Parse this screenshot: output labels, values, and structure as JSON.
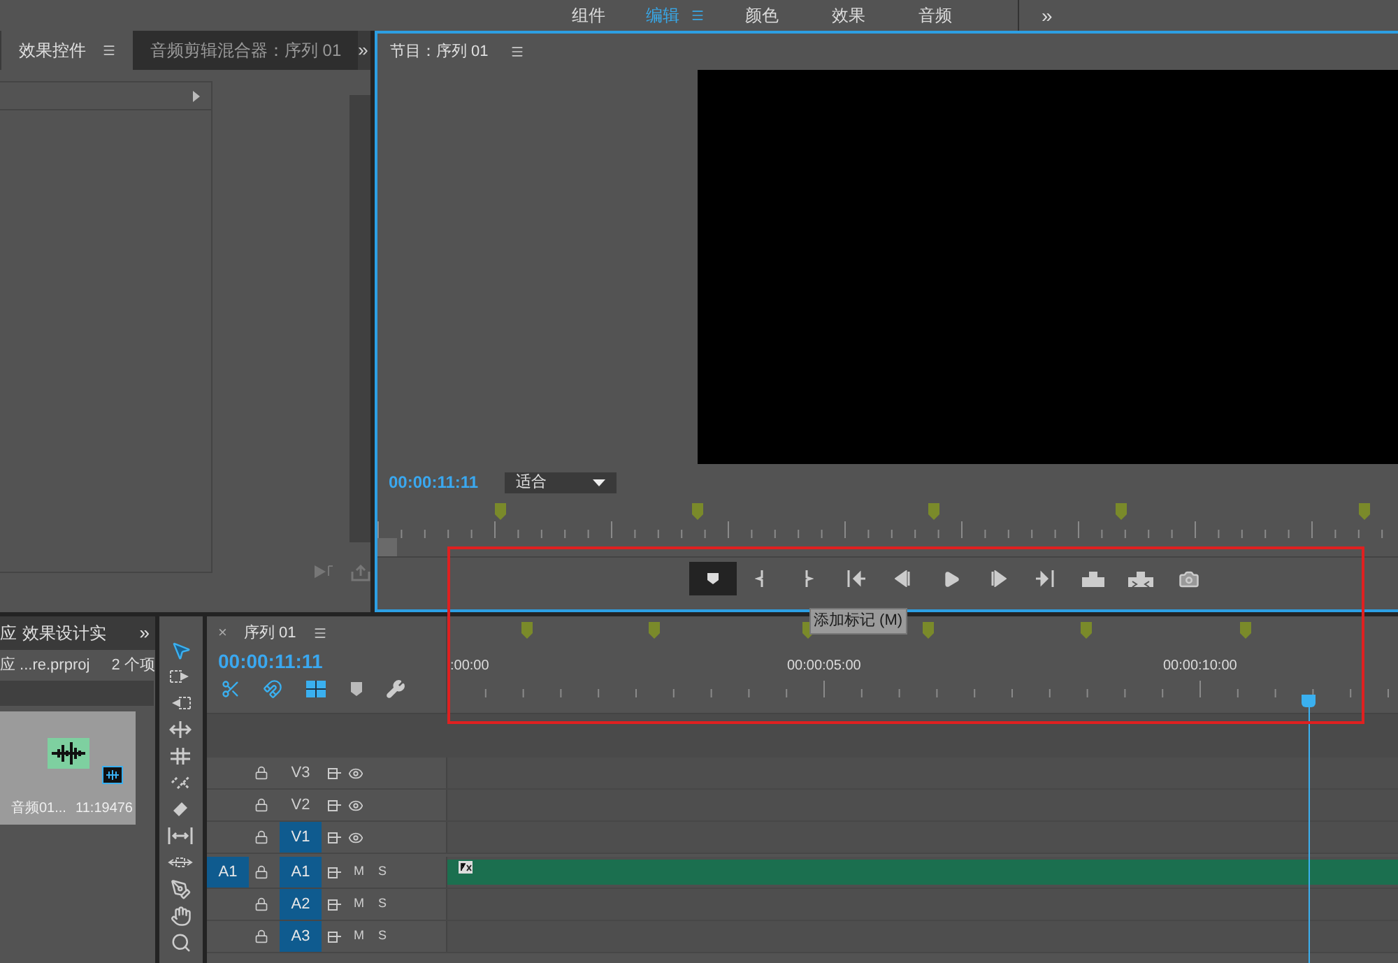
{
  "workspaces": [
    {
      "label": "组件",
      "selected": false
    },
    {
      "label": "编辑",
      "selected": true
    },
    {
      "label": "颜色",
      "selected": false
    },
    {
      "label": "效果",
      "selected": false
    },
    {
      "label": "音频",
      "selected": false
    }
  ],
  "workspace_more": "»",
  "effects_panel": {
    "tabs": [
      {
        "label": "效果控件",
        "selected": true
      },
      {
        "label": "音频剪辑混合器：序列 01",
        "selected": false
      }
    ],
    "more": "»"
  },
  "program_monitor": {
    "title": "节目：序列 01",
    "timecode": "00:00:11:11",
    "zoom": "适合",
    "buttons": [
      {
        "kind": "marker",
        "hovered": true
      },
      {
        "kind": "mark-in",
        "hovered": false
      },
      {
        "kind": "mark-out",
        "hovered": false
      },
      {
        "kind": "go-in",
        "hovered": false
      },
      {
        "kind": "step-back",
        "hovered": false
      },
      {
        "kind": "play",
        "hovered": false
      },
      {
        "kind": "step-forward",
        "hovered": false
      },
      {
        "kind": "go-out",
        "hovered": false
      },
      {
        "kind": "lift",
        "hovered": false
      },
      {
        "kind": "extract",
        "hovered": false
      },
      {
        "kind": "export-frame",
        "hovered": false
      }
    ],
    "tooltip": "添加标记 (M)"
  },
  "project_panel": {
    "tabs": [
      "应",
      "效果设计实"
    ],
    "more": "»",
    "project_name": "应 ...re.prproj",
    "item_count": "2 个项",
    "clip": {
      "name": "音频01...",
      "duration": "11:19476"
    }
  },
  "timeline": {
    "title": "序列 01",
    "close": "×",
    "timecode": "00:00:11:11",
    "ruler_labels": [
      ":00:00",
      "00:00:05:00",
      "00:00:10:00"
    ],
    "tracks": [
      {
        "kind": "video",
        "name": "V3",
        "targeted": false
      },
      {
        "kind": "video",
        "name": "V2",
        "targeted": false
      },
      {
        "kind": "video",
        "name": "V1",
        "targeted": true
      },
      {
        "kind": "audio",
        "name": "A1",
        "source": "A1",
        "targeted": true,
        "mute": "M",
        "solo": "S",
        "has_clip": true
      },
      {
        "kind": "audio",
        "name": "A2",
        "targeted": true,
        "mute": "M",
        "solo": "S",
        "has_clip": false
      },
      {
        "kind": "audio",
        "name": "A3",
        "targeted": true,
        "mute": "M",
        "solo": "S",
        "has_clip": false
      }
    ]
  }
}
